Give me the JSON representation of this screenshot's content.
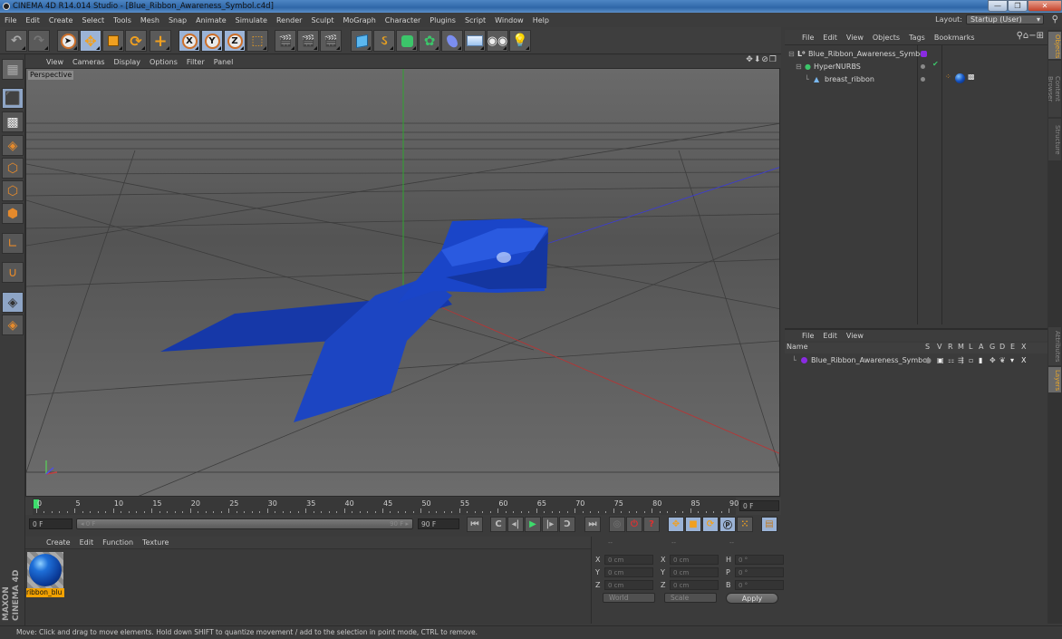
{
  "window": {
    "title": "CINEMA 4D R14.014 Studio - [Blue_Ribbon_Awareness_Symbol.c4d]",
    "minimize": "—",
    "restore": "❐",
    "close": "✕"
  },
  "menubar": [
    "File",
    "Edit",
    "Create",
    "Select",
    "Tools",
    "Mesh",
    "Snap",
    "Animate",
    "Simulate",
    "Render",
    "Sculpt",
    "MoGraph",
    "Character",
    "Plugins",
    "Script",
    "Window",
    "Help"
  ],
  "layout": {
    "label": "Layout:",
    "value": "Startup (User)"
  },
  "toolbar": {
    "undo": "↶",
    "redo": "↷",
    "axis_x": "X",
    "axis_y": "Y",
    "axis_z": "Z"
  },
  "viewport": {
    "menu": [
      "View",
      "Cameras",
      "Display",
      "Options",
      "Filter",
      "Panel"
    ],
    "camera_label": "Perspective",
    "nav_icons": "✥⬇⊘❐",
    "object_color": "#1e40b0"
  },
  "timeline": {
    "ticks": [
      "0",
      "5",
      "10",
      "15",
      "20",
      "25",
      "30",
      "35",
      "40",
      "45",
      "50",
      "55",
      "60",
      "65",
      "70",
      "75",
      "80",
      "85",
      "90"
    ],
    "current_frame": "0 F",
    "start_field": "0 F",
    "range_start": "◂ 0 F",
    "range_end": "90 F ▸",
    "end_field": "90 F"
  },
  "material_manager": {
    "menu": [
      "Create",
      "Edit",
      "Function",
      "Texture"
    ],
    "materials": [
      {
        "name": "ribbon_blu"
      }
    ]
  },
  "branding": "MAXON CINEMA 4D",
  "coordinates": {
    "headers": [
      "--",
      "--",
      "--"
    ],
    "rows": [
      {
        "l1": "X",
        "v1": "0 cm",
        "l2": "X",
        "v2": "0 cm",
        "l3": "H",
        "v3": "0 °"
      },
      {
        "l1": "Y",
        "v1": "0 cm",
        "l2": "Y",
        "v2": "0 cm",
        "l3": "P",
        "v3": "0 °"
      },
      {
        "l1": "Z",
        "v1": "0 cm",
        "l2": "Z",
        "v2": "0 cm",
        "l3": "B",
        "v3": "0 °"
      }
    ],
    "mode_select": "World",
    "size_select": "Scale",
    "apply_label": "Apply"
  },
  "object_manager": {
    "menu": [
      "File",
      "Edit",
      "View",
      "Objects",
      "Tags",
      "Bookmarks"
    ],
    "objects": [
      {
        "name": "Blue_Ribbon_Awareness_Symbol",
        "icon": "null-icon",
        "indent": 0
      },
      {
        "name": "HyperNURBS",
        "icon": "hypernurbs-icon",
        "indent": 1
      },
      {
        "name": "breast_ribbon",
        "icon": "polygon-object-icon",
        "indent": 2
      }
    ]
  },
  "layer_manager": {
    "menu": [
      "File",
      "Edit",
      "View"
    ],
    "columns": [
      "Name",
      "S",
      "V",
      "R",
      "M",
      "L",
      "A",
      "G",
      "D",
      "E",
      "X"
    ],
    "layers": [
      {
        "name": "Blue_Ribbon_Awareness_Symbol",
        "color": "#8a2be2"
      }
    ]
  },
  "right_tabs": [
    "Objects",
    "Content Browser",
    "Structure",
    "Attributes",
    "Layers"
  ],
  "status": "Move: Click and drag to move elements. Hold down SHIFT to quantize movement / add to the selection in point mode, CTRL to remove."
}
